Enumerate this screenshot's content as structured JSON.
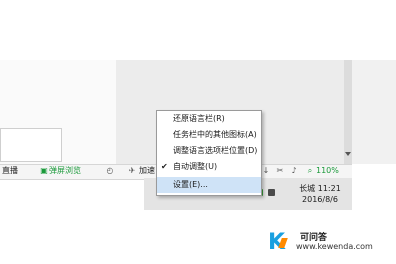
{
  "statusbar": {
    "left_label": "直播",
    "browser_label": "弹屏浏览",
    "speed_label": "加速",
    "zoom_label": "110%"
  },
  "context_menu": {
    "items": [
      {
        "label": "还原语言栏(R)",
        "checked": false,
        "highlighted": false
      },
      {
        "label": "任务栏中的其他图标(A)",
        "checked": false,
        "highlighted": false
      },
      {
        "label": "调整语言选项栏位置(D)",
        "checked": false,
        "highlighted": false
      },
      {
        "label": "自动调整(U)",
        "checked": true,
        "highlighted": false
      },
      {
        "label": "设置(E)...",
        "checked": false,
        "highlighted": true
      }
    ]
  },
  "tray": {
    "ime_label": "长城",
    "time": "11:21",
    "date": "2016/8/6"
  },
  "watermark": {
    "logo_letter": "K",
    "site_name": "可问答",
    "site_url": "www.kewenda.com"
  },
  "colors": {
    "menu_highlight": "#cfe3f7",
    "status_green": "#1a9a3a",
    "watermark_blue": "#1aa0e0",
    "watermark_orange": "#ff8a00"
  }
}
